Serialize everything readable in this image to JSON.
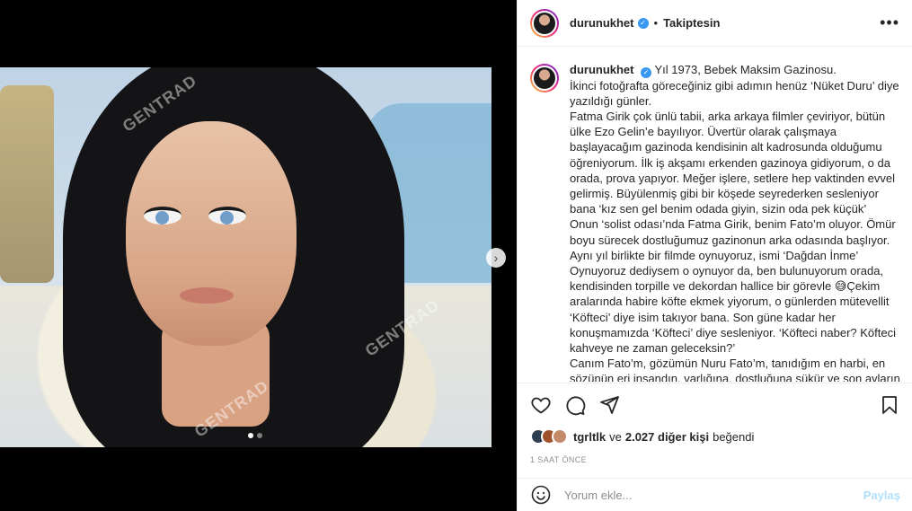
{
  "post": {
    "username": "durunukhet",
    "follow_status": "Takiptesin",
    "separator": "•"
  },
  "caption": {
    "username": "durunukhet",
    "lines": [
      "Yıl 1973, Bebek Maksim Gazinosu.",
      "İkinci fotoğrafta göreceğiniz gibi adımın henüz ‘Nüket Duru’ diye yazıldığı günler.",
      "Fatma Girik çok ünlü tabii, arka arkaya filmler çeviriyor, bütün ülke Ezo Gelin’e bayılıyor. Üvertür olarak çalışmaya başlayacağım gazinoda kendisinin alt kadrosunda olduğumu öğreniyorum. İlk iş akşamı erkenden gazinoya gidiyorum, o da orada, prova yapıyor. Meğer işlere, setlere hep vaktinden evvel gelirmiş. Büyülenmiş gibi bir köşede seyrederken sesleniyor bana ‘kız sen gel benim odada giyin, sizin oda pek küçük’",
      "Onun ‘solist odası’nda Fatma Girik, benim Fato’m oluyor. Ömür boyu sürecek dostluğumuz gazinonun arka odasında başlıyor.",
      "Aynı yıl birlikte bir filmde oynuyoruz, ismi ‘Dağdan İnme’ Oynuyoruz dediysem o oynuyor da, ben bulunuyorum orada, kendisinden torpille ve dekordan hallice bir görevle 😅Çekim aralarında habire köfte ekmek yiyorum, o günlerden mütevellit ‘Köfteci’ diye isim takıyor bana. Son güne kadar her konuşmamızda ‘Köfteci’ diye sesleniyor. ‘Köfteci naber? Köfteci kahveye ne zaman geleceksin?’",
      "Canım Fato’m, gözümün Nuru Fato’m, tanıdığım en harbi, en sözünün eri insandın, varlığına, dostluğuna şükür ve son ayların hasretiyle yolcuyorum seni. Memduh Abi’ye, en büyük aşkına"
    ]
  },
  "likes": {
    "first_liker": "tgrltlk",
    "connector": "ve",
    "others": "2.027 diğer kişi",
    "suffix": "beğendi"
  },
  "timestamp": "1 SAAT ÖNCE",
  "comment": {
    "placeholder": "Yorum ekle...",
    "submit_label": "Paylaş"
  },
  "media": {
    "watermark": "GENTRAD",
    "slide_count": 2,
    "active_slide": 1
  },
  "icons": {
    "like": "heart-icon",
    "comment": "comment-icon",
    "share": "send-icon",
    "save": "bookmark-icon",
    "emoji": "emoji-icon",
    "more": "more-options-icon",
    "next": "chevron-right-icon",
    "verified": "verified-badge-icon"
  },
  "colors": {
    "accent_blue": "#3897f0",
    "share_disabled": "#b2dffc",
    "muted_text": "#8e8e8e"
  }
}
